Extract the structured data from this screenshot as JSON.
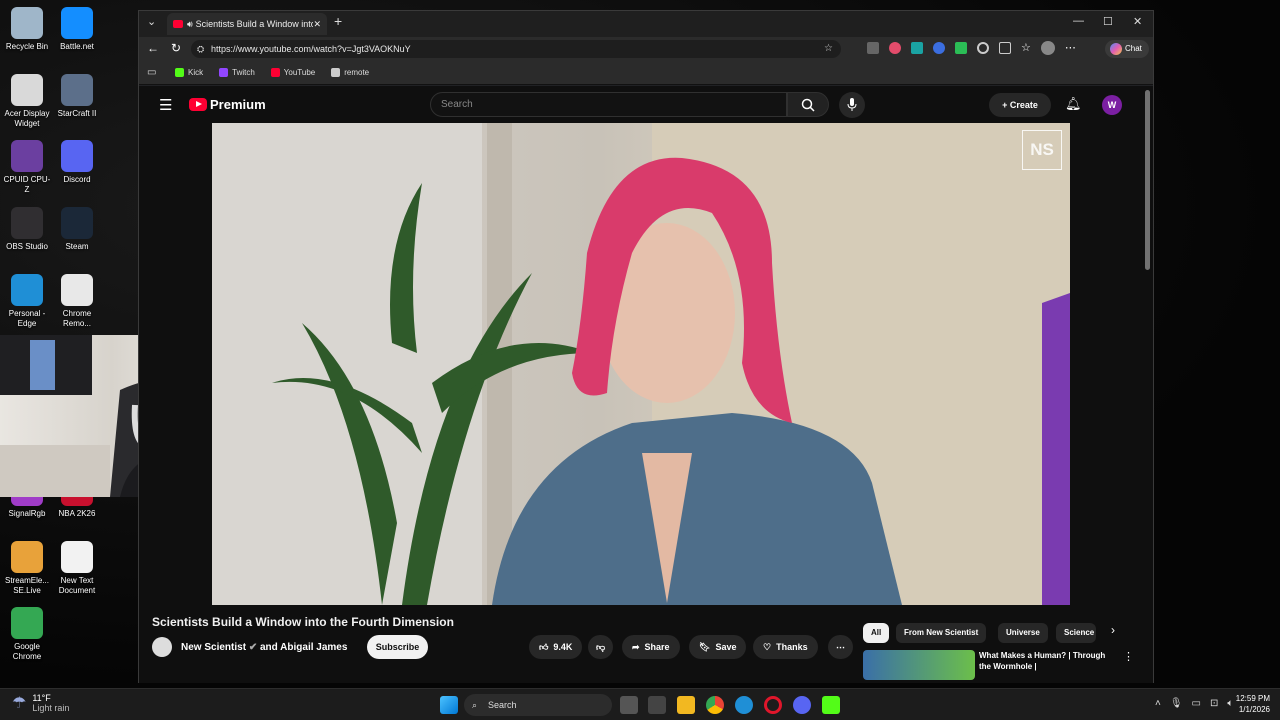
{
  "desktop": {
    "icons": [
      {
        "label": "Recycle Bin",
        "color": "#9fb6c9"
      },
      {
        "label": "Battle.net",
        "color": "#148eff"
      },
      {
        "label": "Acer Display Widget",
        "color": "#d9d9d9"
      },
      {
        "label": "StarCraft II",
        "color": "#5c6f8a"
      },
      {
        "label": "CPUID CPU-Z",
        "color": "#6b3fa0"
      },
      {
        "label": "Discord",
        "color": "#5865f2"
      },
      {
        "label": "OBS Studio",
        "color": "#302e31"
      },
      {
        "label": "Steam",
        "color": "#1b2838"
      },
      {
        "label": "Personal - Edge",
        "color": "#1f8fd6"
      },
      {
        "label": "Chrome Remo...",
        "color": "#e8e8e8"
      },
      {
        "label": "SignalRgb",
        "color": "#a03cc8"
      },
      {
        "label": "NBA 2K26",
        "color": "#c8102e"
      },
      {
        "label": "StreamEle... SE.Live",
        "color": "#e8a23a"
      },
      {
        "label": "New Text Document",
        "color": "#f2f2f2"
      },
      {
        "label": "Google Chrome",
        "color": "#34a853"
      }
    ]
  },
  "browser": {
    "tab_title": "Scientists Build a Window into",
    "url": "https://www.youtube.com/watch?v=Jgt3VAOKNuY",
    "chat_label": "Chat",
    "bookmarks": [
      {
        "label": "Kick",
        "color": "#53fc18"
      },
      {
        "label": "Twitch",
        "color": "#9146ff"
      },
      {
        "label": "YouTube",
        "color": "#ff0033"
      },
      {
        "label": "remote",
        "color": "#cccccc"
      }
    ]
  },
  "youtube": {
    "logo_text": "Premium",
    "search_placeholder": "Search",
    "create_label": "Create",
    "avatar_letter": "W",
    "player_watermark": "NS",
    "video_title": "Scientists Build a Window into the Fourth Dimension",
    "channel": "New Scientist",
    "channel_and": "and Abigail James",
    "subscribe_label": "Subscribe",
    "likes": "9.4K",
    "share_label": "Share",
    "save_label": "Save",
    "thanks_label": "Thanks",
    "chips": [
      "All",
      "From New Scientist",
      "Universe",
      "Science"
    ],
    "recommend_title": "What Makes a Human? | Through the Wormhole |"
  },
  "taskbar": {
    "weather_temp": "11°F",
    "weather_desc": "Light rain",
    "search_label": "Search",
    "time": "12:59 PM",
    "date": "1/1/2026"
  }
}
